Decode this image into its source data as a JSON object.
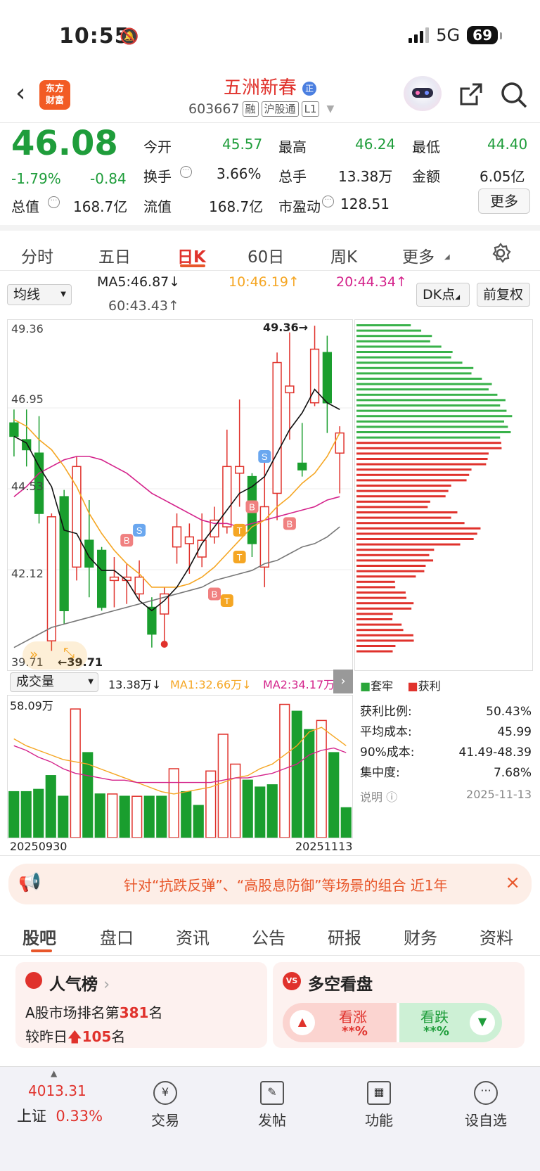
{
  "status_bar": {
    "time": "10:55",
    "network": "5G",
    "battery": "69"
  },
  "header": {
    "logo_line1": "东方",
    "logo_line2": "财富",
    "stock_name": "五洲新春",
    "stock_code": "603667",
    "tags": [
      "融",
      "沪股通",
      "L1"
    ],
    "badge": "正"
  },
  "quote": {
    "price": "46.08",
    "change_pct": "-1.79%",
    "change": "-0.84",
    "stats": [
      {
        "label": "今开",
        "value": "45.57",
        "color": "green"
      },
      {
        "label": "最高",
        "value": "46.24",
        "color": "green"
      },
      {
        "label": "最低",
        "value": "44.40",
        "color": "green"
      },
      {
        "label": "换手",
        "value": "3.66%",
        "color": "plain"
      },
      {
        "label": "总手",
        "value": "13.38万",
        "color": "plain"
      },
      {
        "label": "金额",
        "value": "6.05亿",
        "color": "plain"
      },
      {
        "label": "总值",
        "value": "168.7亿",
        "color": "plain"
      },
      {
        "label": "流值",
        "value": "168.7亿",
        "color": "plain"
      },
      {
        "label": "市盈动",
        "value": "128.51",
        "color": "plain"
      }
    ],
    "more_label": "更多"
  },
  "period_tabs": [
    "分时",
    "五日",
    "日K",
    "60日",
    "周K",
    "更多"
  ],
  "active_period": "日K",
  "chart_toolbar": {
    "indicator": "均线",
    "ma5": "MA5:46.87",
    "ma10": "10:46.19",
    "ma20": "20:44.34",
    "ma60": "60:43.43",
    "dk_label": "DK点",
    "adjust_label": "前复权"
  },
  "chart_data": [
    {
      "type": "candlestick",
      "y_ticks": [
        "49.36",
        "46.95",
        "44.53",
        "42.12",
        "39.71"
      ],
      "ylim": [
        39.71,
        49.36
      ],
      "high_label": "49.36",
      "low_label": "39.71",
      "signal_labels": [
        "B",
        "S",
        "T",
        "B",
        "T",
        "B",
        "T",
        "S",
        "B"
      ],
      "candles": [
        {
          "o": 46.5,
          "c": 46.1,
          "h": 46.9,
          "l": 45.5
        },
        {
          "o": 46.0,
          "c": 45.7,
          "h": 46.9,
          "l": 45.2
        },
        {
          "o": 45.6,
          "c": 43.8,
          "h": 46.7,
          "l": 43.5
        },
        {
          "o": 40.0,
          "c": 43.7,
          "h": 43.8,
          "l": 39.7
        },
        {
          "o": 44.3,
          "c": 40.9,
          "h": 44.5,
          "l": 40.5
        },
        {
          "o": 42.2,
          "c": 45.2,
          "h": 45.5,
          "l": 41.8
        },
        {
          "o": 43.0,
          "c": 42.2,
          "h": 44.2,
          "l": 41.3
        },
        {
          "o": 42.7,
          "c": 41.0,
          "h": 42.8,
          "l": 40.9
        },
        {
          "o": 41.8,
          "c": 41.9,
          "h": 42.5,
          "l": 41.0
        },
        {
          "o": 41.8,
          "c": 41.9,
          "h": 42.3,
          "l": 41.1
        },
        {
          "o": 41.4,
          "c": 41.9,
          "h": 42.4,
          "l": 41.2
        },
        {
          "o": 41.0,
          "c": 40.2,
          "h": 41.3,
          "l": 39.8
        },
        {
          "o": 40.8,
          "c": 41.4,
          "h": 41.6,
          "l": 40.0
        },
        {
          "o": 42.8,
          "c": 43.4,
          "h": 43.8,
          "l": 42.3
        },
        {
          "o": 42.9,
          "c": 43.1,
          "h": 43.5,
          "l": 42.0
        },
        {
          "o": 42.5,
          "c": 43.0,
          "h": 43.8,
          "l": 42.2
        },
        {
          "o": 43.1,
          "c": 43.6,
          "h": 44.0,
          "l": 42.9
        },
        {
          "o": 43.4,
          "c": 45.2,
          "h": 46.3,
          "l": 43.2
        },
        {
          "o": 45.0,
          "c": 45.2,
          "h": 47.2,
          "l": 44.0
        },
        {
          "o": 44.9,
          "c": 42.9,
          "h": 45.0,
          "l": 42.5
        },
        {
          "o": 42.2,
          "c": 44.0,
          "h": 45.4,
          "l": 41.6
        },
        {
          "o": 44.4,
          "c": 48.3,
          "h": 48.6,
          "l": 43.6
        },
        {
          "o": 47.4,
          "c": 47.6,
          "h": 49.2,
          "l": 46.0
        },
        {
          "o": 45.3,
          "c": 45.1,
          "h": 46.5,
          "l": 44.9
        },
        {
          "o": 47.1,
          "c": 48.7,
          "h": 49.4,
          "l": 47.0
        },
        {
          "o": 48.6,
          "c": 47.1,
          "h": 49.1,
          "l": 46.2
        },
        {
          "o": 45.6,
          "c": 46.2,
          "h": 46.4,
          "l": 44.4
        }
      ],
      "ma5": [
        46.1,
        45.9,
        45.2,
        44.6,
        43.3,
        43.2,
        42.5,
        42.1,
        42.1,
        41.8,
        41.2,
        40.9,
        41.2,
        41.6,
        42.2,
        42.9,
        43.4,
        43.9,
        44.4,
        44.6,
        44.9,
        45.6,
        46.3,
        46.8,
        47.5,
        47.1,
        46.9
      ],
      "ma10": [
        46.6,
        46.4,
        46.0,
        45.7,
        45.2,
        44.6,
        43.8,
        43.2,
        42.7,
        42.3,
        42.0,
        41.6,
        41.6,
        41.6,
        41.7,
        41.9,
        42.2,
        42.6,
        43.0,
        43.4,
        43.6,
        44.0,
        44.3,
        44.7,
        45.0,
        45.5,
        46.2
      ],
      "ma20": [
        44.3,
        44.6,
        45.0,
        45.2,
        45.4,
        45.5,
        45.5,
        45.4,
        45.2,
        45.0,
        44.7,
        44.4,
        44.2,
        44.0,
        43.8,
        43.6,
        43.5,
        43.5,
        43.4,
        43.5,
        43.6,
        43.7,
        43.8,
        43.9,
        44.0,
        44.2,
        44.3
      ],
      "ma60": [
        39.8,
        40.0,
        40.2,
        40.4,
        40.5,
        40.6,
        40.7,
        40.8,
        40.9,
        41.0,
        41.1,
        41.2,
        41.3,
        41.4,
        41.5,
        41.6,
        41.8,
        41.9,
        42.0,
        42.1,
        42.3,
        42.4,
        42.6,
        42.8,
        42.9,
        43.1,
        43.4
      ]
    },
    {
      "type": "bar",
      "title": "成交量",
      "total": "13.38万",
      "ma1": "MA1:32.66万",
      "ma2": "MA2:34.17万",
      "max_label": "58.09万",
      "start_date": "20250930",
      "end_date": "20251113",
      "values": [
        20,
        20,
        21,
        27,
        18,
        56,
        37,
        19,
        19,
        18,
        18,
        18,
        18,
        30,
        20,
        14,
        29,
        45,
        32,
        25,
        22,
        23,
        58,
        55,
        47,
        51,
        37,
        13
      ],
      "up": [
        false,
        false,
        false,
        false,
        false,
        true,
        false,
        false,
        true,
        false,
        true,
        false,
        false,
        true,
        false,
        false,
        true,
        true,
        true,
        false,
        false,
        false,
        true,
        false,
        false,
        true,
        false,
        false
      ],
      "ma1_values": [
        43,
        40,
        38,
        36,
        34,
        33,
        32,
        30,
        28,
        26,
        24,
        22,
        20,
        19,
        20,
        21,
        22,
        24,
        26,
        27,
        30,
        32,
        36,
        40,
        46,
        48,
        44,
        40
      ],
      "ma2_values": [
        40,
        38,
        35,
        33,
        30,
        28,
        27,
        26,
        25,
        25,
        24,
        24,
        24,
        24,
        24,
        24,
        24,
        25,
        26,
        26,
        27,
        28,
        30,
        32,
        36,
        38,
        39,
        37
      ]
    }
  ],
  "chip": {
    "legend_trapped": "套牢",
    "legend_profit": "获利",
    "rows": [
      {
        "label": "获利比例:",
        "value": "50.43%"
      },
      {
        "label": "平均成本:",
        "value": "45.99"
      },
      {
        "label": "90%成本:",
        "value": "41.49-48.39"
      },
      {
        "label": "集中度:",
        "value": "7.68%"
      }
    ],
    "note_label": "说明",
    "date": "2025-11-13"
  },
  "banner": {
    "text": "针对“抗跌反弹”、“高股息防御”等场景的组合 近1年"
  },
  "bottom_tabs": [
    "股吧",
    "盘口",
    "资讯",
    "公告",
    "研报",
    "财务",
    "资料"
  ],
  "cards": {
    "popularity": {
      "title": "人气榜",
      "rank_prefix": "A股市场排名第",
      "rank": "381",
      "rank_suffix": "名",
      "change_prefix": "较昨日",
      "change": "105",
      "change_suffix": "名"
    },
    "vote": {
      "title": "多空看盘",
      "up_label": "看涨",
      "up_value": "**%",
      "down_label": "看跌",
      "down_value": "**%"
    }
  },
  "bottom_nav": {
    "index_value": "4013.31",
    "index_name": "上证",
    "index_change": "0.33%",
    "items": [
      "交易",
      "发帖",
      "功能",
      "设自选"
    ]
  }
}
